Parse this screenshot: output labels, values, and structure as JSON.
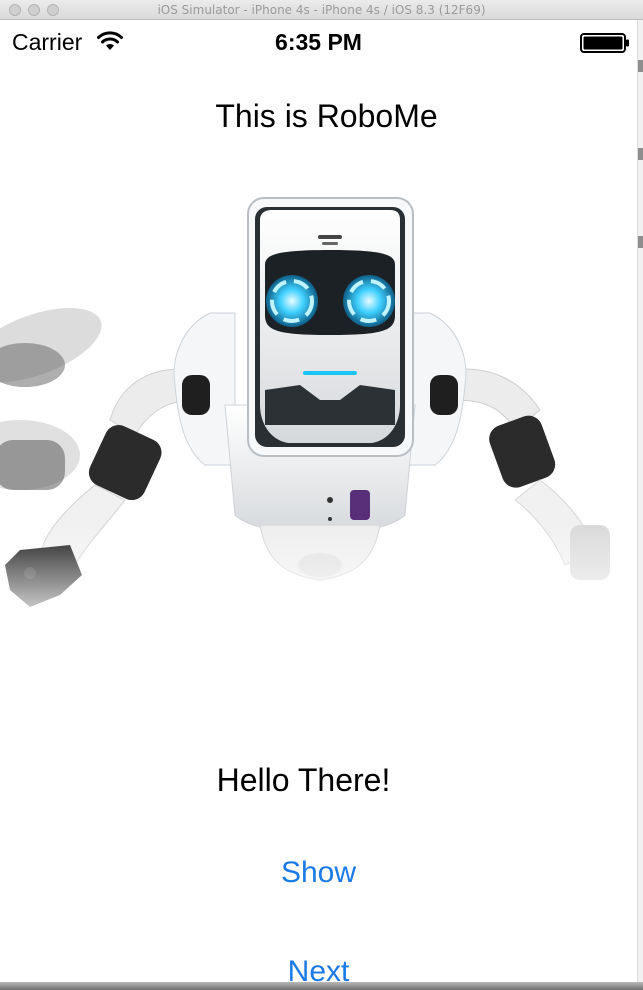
{
  "window": {
    "title": "iOS Simulator - iPhone 4s - iPhone 4s / iOS 8.3 (12F69)"
  },
  "status_bar": {
    "carrier": "Carrier",
    "time": "6:35 PM"
  },
  "main": {
    "title": "This is RoboMe",
    "greeting": "Hello There!",
    "show_label": "Show",
    "next_label": "Next"
  },
  "icons": [
    "wifi-icon",
    "battery-icon",
    "robome-robot-image"
  ],
  "colors": {
    "button_tint": "#1a7ae6",
    "eye_glow": "#19c3f5",
    "background": "#ffffff"
  }
}
